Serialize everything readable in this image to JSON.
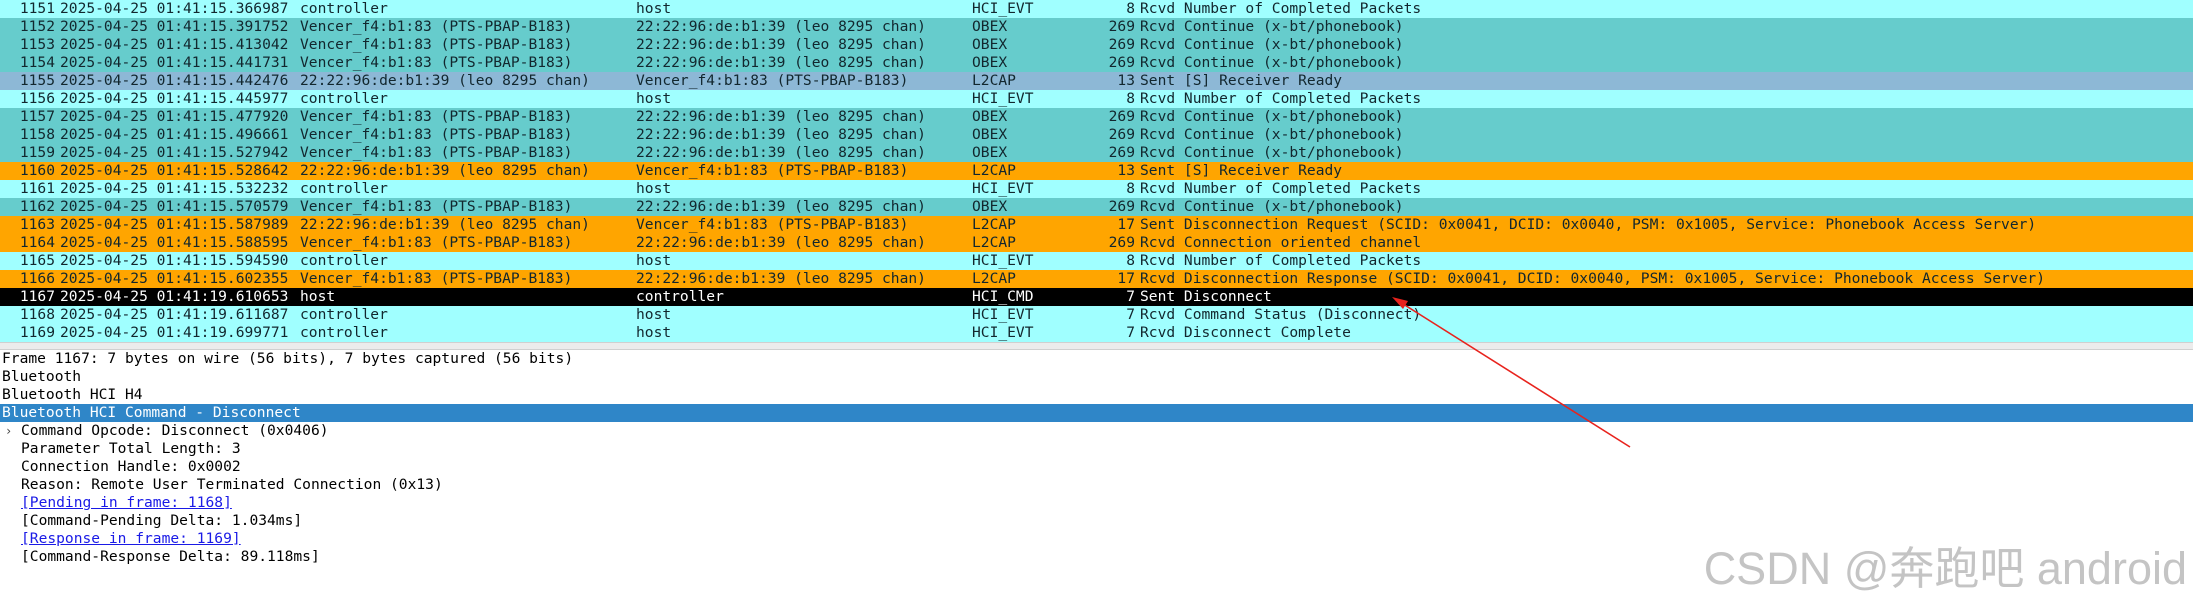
{
  "packets": [
    {
      "no": "1151",
      "time": "2025-04-25 01:41:15.366987",
      "source": "controller",
      "destination": "host",
      "protocol": "HCI_EVT",
      "length": "8",
      "info": "Rcvd Number of Completed Packets",
      "bg": "#a0ffff",
      "fg": "#12272e"
    },
    {
      "no": "1152",
      "time": "2025-04-25 01:41:15.391752",
      "source": "Vencer_f4:b1:83 (PTS-PBAP-B183)",
      "destination": "22:22:96:de:b1:39 (leo 8295 chan)",
      "protocol": "OBEX",
      "length": "269",
      "info": "Rcvd Continue (x-bt/phonebook)",
      "bg": "#66cccc",
      "fg": "#12272e"
    },
    {
      "no": "1153",
      "time": "2025-04-25 01:41:15.413042",
      "source": "Vencer_f4:b1:83 (PTS-PBAP-B183)",
      "destination": "22:22:96:de:b1:39 (leo 8295 chan)",
      "protocol": "OBEX",
      "length": "269",
      "info": "Rcvd Continue (x-bt/phonebook)",
      "bg": "#66cccc",
      "fg": "#12272e"
    },
    {
      "no": "1154",
      "time": "2025-04-25 01:41:15.441731",
      "source": "Vencer_f4:b1:83 (PTS-PBAP-B183)",
      "destination": "22:22:96:de:b1:39 (leo 8295 chan)",
      "protocol": "OBEX",
      "length": "269",
      "info": "Rcvd Continue (x-bt/phonebook)",
      "bg": "#66cccc",
      "fg": "#12272e"
    },
    {
      "no": "1155",
      "time": "2025-04-25 01:41:15.442476",
      "source": "22:22:96:de:b1:39 (leo 8295 chan)",
      "destination": "Vencer_f4:b1:83 (PTS-PBAP-B183)",
      "protocol": "L2CAP",
      "length": "13",
      "info": "Sent [S] Receiver Ready",
      "bg": "#8db8d6",
      "fg": "#12272e"
    },
    {
      "no": "1156",
      "time": "2025-04-25 01:41:15.445977",
      "source": "controller",
      "destination": "host",
      "protocol": "HCI_EVT",
      "length": "8",
      "info": "Rcvd Number of Completed Packets",
      "bg": "#a0ffff",
      "fg": "#12272e"
    },
    {
      "no": "1157",
      "time": "2025-04-25 01:41:15.477920",
      "source": "Vencer_f4:b1:83 (PTS-PBAP-B183)",
      "destination": "22:22:96:de:b1:39 (leo 8295 chan)",
      "protocol": "OBEX",
      "length": "269",
      "info": "Rcvd Continue (x-bt/phonebook)",
      "bg": "#66cccc",
      "fg": "#12272e"
    },
    {
      "no": "1158",
      "time": "2025-04-25 01:41:15.496661",
      "source": "Vencer_f4:b1:83 (PTS-PBAP-B183)",
      "destination": "22:22:96:de:b1:39 (leo 8295 chan)",
      "protocol": "OBEX",
      "length": "269",
      "info": "Rcvd Continue (x-bt/phonebook)",
      "bg": "#66cccc",
      "fg": "#12272e"
    },
    {
      "no": "1159",
      "time": "2025-04-25 01:41:15.527942",
      "source": "Vencer_f4:b1:83 (PTS-PBAP-B183)",
      "destination": "22:22:96:de:b1:39 (leo 8295 chan)",
      "protocol": "OBEX",
      "length": "269",
      "info": "Rcvd Continue (x-bt/phonebook)",
      "bg": "#66cccc",
      "fg": "#12272e"
    },
    {
      "no": "1160",
      "time": "2025-04-25 01:41:15.528642",
      "source": "22:22:96:de:b1:39 (leo 8295 chan)",
      "destination": "Vencer_f4:b1:83 (PTS-PBAP-B183)",
      "protocol": "L2CAP",
      "length": "13",
      "info": "Sent [S] Receiver Ready",
      "bg": "#ffa500",
      "fg": "#12272e"
    },
    {
      "no": "1161",
      "time": "2025-04-25 01:41:15.532232",
      "source": "controller",
      "destination": "host",
      "protocol": "HCI_EVT",
      "length": "8",
      "info": "Rcvd Number of Completed Packets",
      "bg": "#a0ffff",
      "fg": "#12272e"
    },
    {
      "no": "1162",
      "time": "2025-04-25 01:41:15.570579",
      "source": "Vencer_f4:b1:83 (PTS-PBAP-B183)",
      "destination": "22:22:96:de:b1:39 (leo 8295 chan)",
      "protocol": "OBEX",
      "length": "269",
      "info": "Rcvd Continue (x-bt/phonebook)",
      "bg": "#66cccc",
      "fg": "#12272e"
    },
    {
      "no": "1163",
      "time": "2025-04-25 01:41:15.587989",
      "source": "22:22:96:de:b1:39 (leo 8295 chan)",
      "destination": "Vencer_f4:b1:83 (PTS-PBAP-B183)",
      "protocol": "L2CAP",
      "length": "17",
      "info": "Sent Disconnection Request (SCID: 0x0041, DCID: 0x0040, PSM: 0x1005, Service: Phonebook Access Server)",
      "bg": "#ffa500",
      "fg": "#12272e"
    },
    {
      "no": "1164",
      "time": "2025-04-25 01:41:15.588595",
      "source": "Vencer_f4:b1:83 (PTS-PBAP-B183)",
      "destination": "22:22:96:de:b1:39 (leo 8295 chan)",
      "protocol": "L2CAP",
      "length": "269",
      "info": "Rcvd Connection oriented channel",
      "bg": "#ffa500",
      "fg": "#12272e"
    },
    {
      "no": "1165",
      "time": "2025-04-25 01:41:15.594590",
      "source": "controller",
      "destination": "host",
      "protocol": "HCI_EVT",
      "length": "8",
      "info": "Rcvd Number of Completed Packets",
      "bg": "#a0ffff",
      "fg": "#12272e"
    },
    {
      "no": "1166",
      "time": "2025-04-25 01:41:15.602355",
      "source": "Vencer_f4:b1:83 (PTS-PBAP-B183)",
      "destination": "22:22:96:de:b1:39 (leo 8295 chan)",
      "protocol": "L2CAP",
      "length": "17",
      "info": "Rcvd Disconnection Response (SCID: 0x0041, DCID: 0x0040, PSM: 0x1005, Service: Phonebook Access Server)",
      "bg": "#ffa500",
      "fg": "#12272e"
    },
    {
      "no": "1167",
      "time": "2025-04-25 01:41:19.610653",
      "source": "host",
      "destination": "controller",
      "protocol": "HCI_CMD",
      "length": "7",
      "info": "Sent Disconnect",
      "bg": "#000000",
      "fg": "#ffffff"
    },
    {
      "no": "1168",
      "time": "2025-04-25 01:41:19.611687",
      "source": "controller",
      "destination": "host",
      "protocol": "HCI_EVT",
      "length": "7",
      "info": "Rcvd Command Status (Disconnect)",
      "bg": "#a0ffff",
      "fg": "#12272e"
    },
    {
      "no": "1169",
      "time": "2025-04-25 01:41:19.699771",
      "source": "controller",
      "destination": "host",
      "protocol": "HCI_EVT",
      "length": "7",
      "info": "Rcvd Disconnect Complete",
      "bg": "#a0ffff",
      "fg": "#12272e"
    }
  ],
  "details": [
    {
      "text": "Frame 1167: 7 bytes on wire (56 bits), 7 bytes captured (56 bits)",
      "level": 0,
      "selected": false,
      "link": false,
      "expander": ""
    },
    {
      "text": "Bluetooth",
      "level": 0,
      "selected": false,
      "link": false,
      "expander": ""
    },
    {
      "text": "Bluetooth HCI H4",
      "level": 0,
      "selected": false,
      "link": false,
      "expander": ""
    },
    {
      "text": "Bluetooth HCI Command - Disconnect",
      "level": 0,
      "selected": true,
      "link": false,
      "expander": ""
    },
    {
      "text": "Command Opcode: Disconnect (0x0406)",
      "level": 1,
      "selected": false,
      "link": false,
      "expander": "›"
    },
    {
      "text": "Parameter Total Length: 3",
      "level": 1,
      "selected": false,
      "link": false,
      "expander": ""
    },
    {
      "text": "Connection Handle: 0x0002",
      "level": 1,
      "selected": false,
      "link": false,
      "expander": ""
    },
    {
      "text": "Reason: Remote User Terminated Connection (0x13)",
      "level": 1,
      "selected": false,
      "link": false,
      "expander": ""
    },
    {
      "text": "[Pending in frame: 1168]",
      "level": 1,
      "selected": false,
      "link": true,
      "expander": ""
    },
    {
      "text": "[Command-Pending Delta: 1.034ms]",
      "level": 1,
      "selected": false,
      "link": false,
      "expander": ""
    },
    {
      "text": "[Response in frame: 1169]",
      "level": 1,
      "selected": false,
      "link": true,
      "expander": ""
    },
    {
      "text": "[Command-Response Delta: 89.118ms]",
      "level": 1,
      "selected": false,
      "link": false,
      "expander": ""
    }
  ],
  "watermark": "CSDN @奔跑吧 android",
  "annotation_color": "#e8231d"
}
